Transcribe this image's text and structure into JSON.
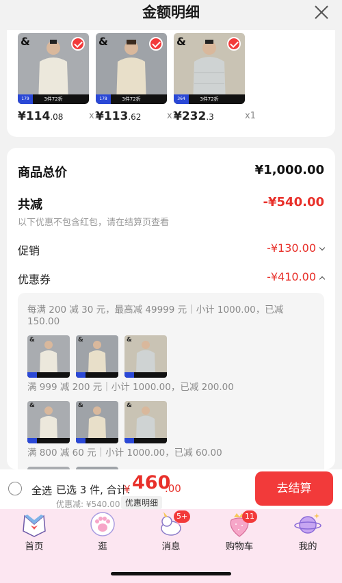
{
  "sheet": {
    "title": "金额明细"
  },
  "products": [
    {
      "price_int": "¥114",
      "price_dec": ".08",
      "qty": "x1",
      "promo": "3件72折",
      "code": "179",
      "brand": "&",
      "shirt_color": "#ece8dc",
      "bg": "#a9acb0"
    },
    {
      "price_int": "¥113",
      "price_dec": ".62",
      "qty": "x1",
      "promo": "3件72折",
      "code": "178",
      "brand": "&",
      "shirt_color": "#e8dfc9",
      "bg": "#9fa3a8"
    },
    {
      "price_int": "¥232",
      "price_dec": ".3",
      "qty": "x1",
      "promo": "3件72折",
      "code": "364",
      "brand": "&",
      "shirt_color": "#cfd3d3",
      "bg": "#c9c3b4"
    }
  ],
  "summary": {
    "total_label": "商品总价",
    "total_value": "¥1,000.00",
    "reduce_label": "共减",
    "reduce_value": "-¥540.00",
    "note": "以下优惠不包含红包，请在结算页查看",
    "promo_label": "促销",
    "promo_value": "-¥130.00",
    "coupon_label": "优惠券",
    "coupon_value": "-¥410.00"
  },
  "coupons": [
    {
      "rule": "每满 200 减 30 元，最高减 49999 元｜小计 1000.00，已减 150.00"
    },
    {
      "rule": "满 999 减 200 元｜小计 1000.00，已减 200.00"
    },
    {
      "rule": "满 800 减 60 元｜小计 1000.00，已减 60.00"
    }
  ],
  "bottom_bar": {
    "select_all": "全选",
    "selected_info": "已选 3 件, 合计:",
    "total_symbol": "¥",
    "total_int": "460",
    "total_dec": ".00",
    "discount_text": "优惠减: ¥540.00",
    "detail_chip": "优惠明细",
    "checkout": "去结算"
  },
  "tabs": [
    {
      "label": "首页",
      "icon": "sailor-collar-icon"
    },
    {
      "label": "逛",
      "icon": "paw-icon"
    },
    {
      "label": "消息",
      "icon": "unicorn-icon",
      "badge": "5+"
    },
    {
      "label": "购物车",
      "icon": "strawberry-icon",
      "badge": "11"
    },
    {
      "label": "我的",
      "icon": "planet-icon"
    }
  ],
  "colors": {
    "accent": "#f23a3a",
    "tabbar_bg": "#fce6f1",
    "discount_red": "#e8302a"
  }
}
